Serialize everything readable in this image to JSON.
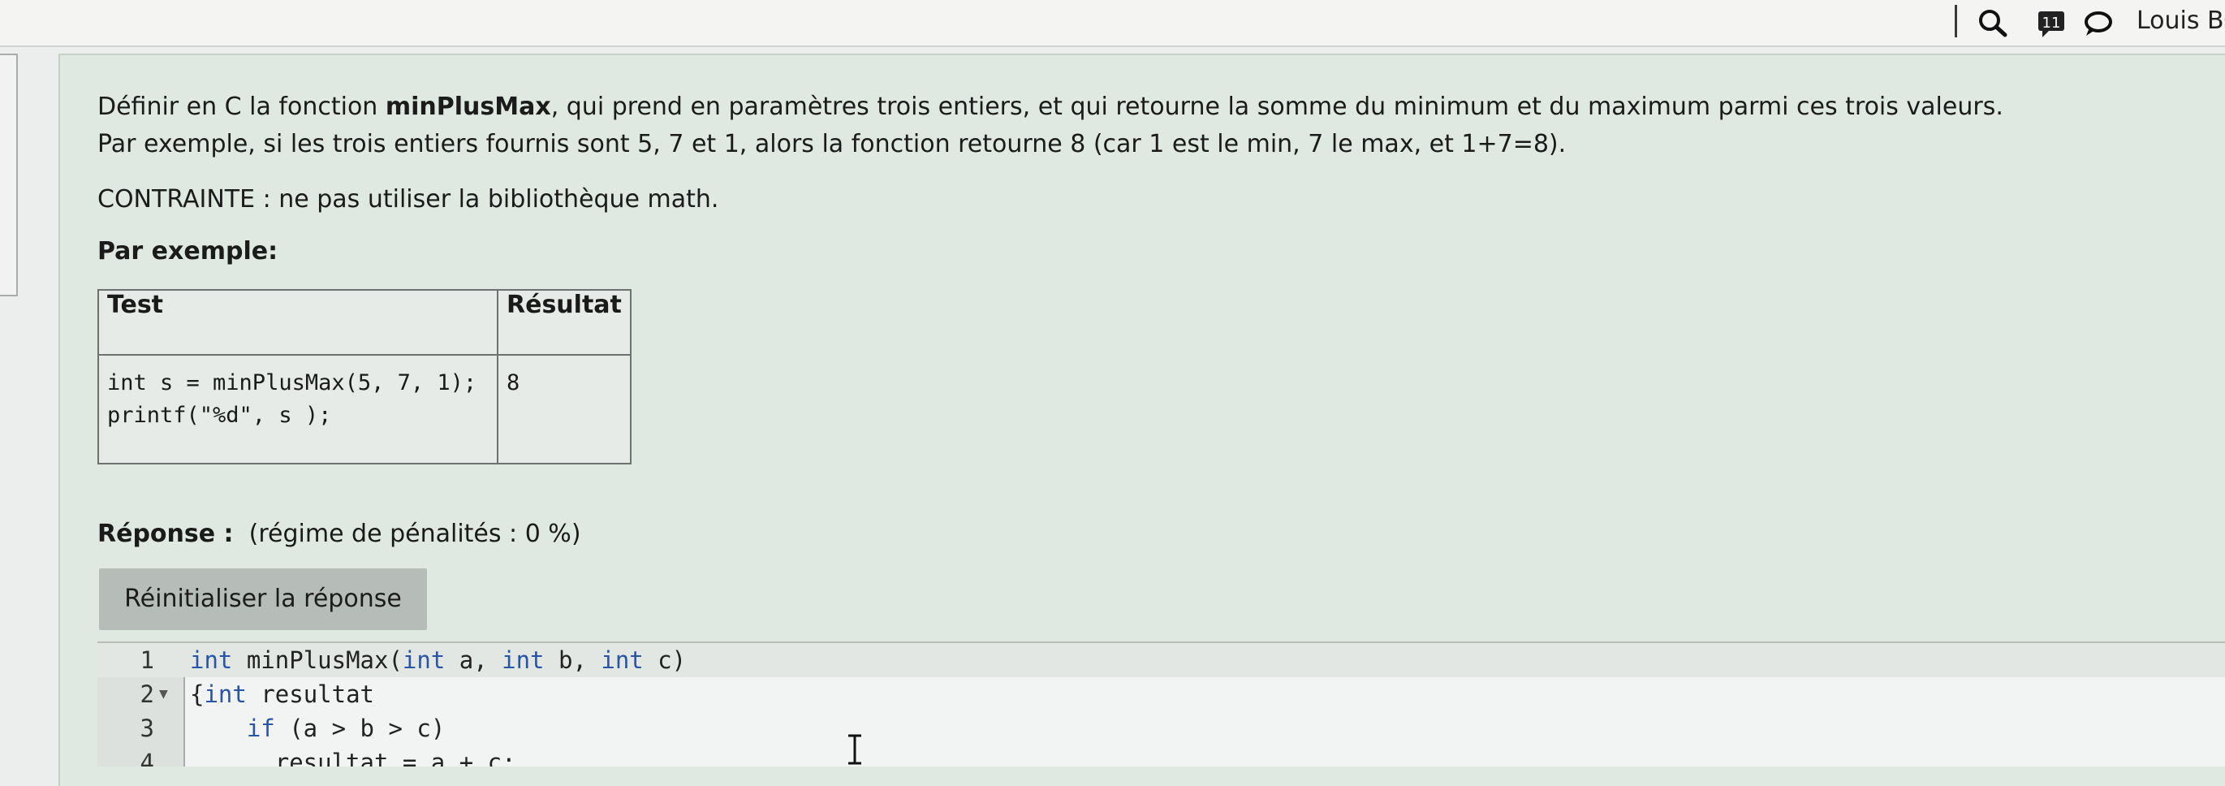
{
  "topbar": {
    "search_icon": "search-icon",
    "messages_badge": "11",
    "messages_icon": "messages-icon",
    "chat_icon": "chat-bubble-icon",
    "user_name": "Louis BC"
  },
  "question": {
    "line1_pre": "Définir en C la fonction ",
    "line1_bold": "minPlusMax",
    "line1_post": ", qui prend en paramètres trois entiers, et qui retourne la somme du minimum et du maximum parmi ces trois valeurs.",
    "line2": "Par exemple, si les trois entiers fournis sont 5, 7 et 1, alors la fonction retourne 8 (car 1 est le min, 7 le max, et 1+7=8).",
    "line3": "CONTRAINTE : ne pas utiliser la bibliothèque math.",
    "example_heading": "Par exemple:"
  },
  "example_table": {
    "headers": [
      "Test",
      "Résultat"
    ],
    "rows": [
      {
        "test_line1": "int s = minPlusMax(5, 7, 1);",
        "test_line2": "printf(\"%d\", s );",
        "result": "8"
      }
    ]
  },
  "answer": {
    "label": "Réponse :",
    "penalty": "(régime de pénalités : 0 %)",
    "reset_button": "Réinitialiser la réponse"
  },
  "editor": {
    "lines": [
      {
        "num": "1",
        "text": "int minPlusMax(int a, int b, int c)"
      },
      {
        "num": "2",
        "text": "{int resultat"
      },
      {
        "num": "3",
        "text": "    if (a > b > c)"
      },
      {
        "num": "4",
        "text": "      resultat = a + c;"
      }
    ]
  },
  "colors": {
    "card_background": "#dfe8e1",
    "keyword": "#2855a8",
    "button": "#b6bcb8"
  }
}
